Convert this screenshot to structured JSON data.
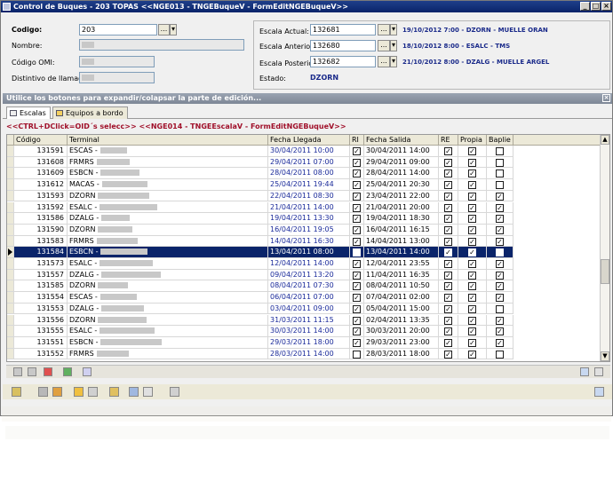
{
  "window": {
    "title": "Control de Buques - 203  TOPAS   <<NGE013 - TNGEBuqueV - FormEditNGEBuqueV>>",
    "btn_min": "_",
    "btn_max": "□",
    "btn_close": "×"
  },
  "form": {
    "codigo_label": "Codigo:",
    "codigo_value": "203",
    "nombre_label": "Nombre:",
    "omi_label": "Código OMI:",
    "distintivo_label": "Distintivo de llamada:",
    "lookup_btn": "...",
    "escala_actual_label": "Escala Actual:",
    "escala_actual_value": "132681",
    "escala_actual_info": "19/10/2012 7:00 - DZORN - MUELLE ORAN",
    "escala_anterior_label": "Escala Anterior:",
    "escala_anterior_value": "132680",
    "escala_anterior_info": "18/10/2012 8:00 - ESALC - TMS",
    "escala_posterior_label": "Escala Posterior:",
    "escala_posterior_value": "132682",
    "escala_posterior_info": "21/10/2012 8:00 - DZALG - MUELLE ARGEL",
    "estado_label": "Estado:",
    "estado_value": "DZORN"
  },
  "infobar": {
    "text": "Utilice los botones para expandir/colapsar la parte de edición..."
  },
  "tabs": [
    {
      "label": "Escalas"
    },
    {
      "label": "Equipos a bordo"
    }
  ],
  "context_line": "<<CTRL+DClick=OID´s selecc>> <<NGE014 - TNGEEscalaV - FormEditNGEBuqueV>>",
  "grid": {
    "columns": [
      "Código",
      "Terminal",
      "Fecha Llegada",
      "RI",
      "Fecha Salida",
      "RE",
      "Propia",
      "Baplie"
    ],
    "rows": [
      {
        "codigo": "131591",
        "terminal": "ESCAS -",
        "llegada": "30/04/2011 10:00",
        "ri": true,
        "salida": "30/04/2011 14:00",
        "re": true,
        "propia": true,
        "baplie": false
      },
      {
        "codigo": "131608",
        "terminal": "FRMRS",
        "llegada": "29/04/2011 07:00",
        "ri": true,
        "salida": "29/04/2011 09:00",
        "re": true,
        "propia": true,
        "baplie": false
      },
      {
        "codigo": "131609",
        "terminal": "ESBCN -",
        "llegada": "28/04/2011 08:00",
        "ri": true,
        "salida": "28/04/2011 14:00",
        "re": true,
        "propia": true,
        "baplie": false
      },
      {
        "codigo": "131612",
        "terminal": "MACAS -",
        "llegada": "25/04/2011 19:44",
        "ri": true,
        "salida": "25/04/2011 20:30",
        "re": true,
        "propia": true,
        "baplie": false
      },
      {
        "codigo": "131593",
        "terminal": "DZORN",
        "llegada": "22/04/2011 08:30",
        "ri": true,
        "salida": "23/04/2011 22:00",
        "re": true,
        "propia": true,
        "baplie": true
      },
      {
        "codigo": "131592",
        "terminal": "ESALC -",
        "llegada": "21/04/2011 14:00",
        "ri": true,
        "salida": "21/04/2011 20:00",
        "re": true,
        "propia": true,
        "baplie": true
      },
      {
        "codigo": "131586",
        "terminal": "DZALG -",
        "llegada": "19/04/2011 13:30",
        "ri": true,
        "salida": "19/04/2011 18:30",
        "re": true,
        "propia": true,
        "baplie": true
      },
      {
        "codigo": "131590",
        "terminal": "DZORN",
        "llegada": "16/04/2011 19:05",
        "ri": true,
        "salida": "16/04/2011 16:15",
        "re": true,
        "propia": true,
        "baplie": true
      },
      {
        "codigo": "131583",
        "terminal": "FRMRS",
        "llegada": "14/04/2011 16:30",
        "ri": true,
        "salida": "14/04/2011 13:00",
        "re": true,
        "propia": true,
        "baplie": true
      },
      {
        "codigo": "131584",
        "terminal": "ESBCN -",
        "llegada": "13/04/2011 08:00",
        "ri": false,
        "salida": "13/04/2011 14:00",
        "re": true,
        "propia": true,
        "baplie": false
      },
      {
        "codigo": "131573",
        "terminal": "ESALC -",
        "llegada": "12/04/2011 14:00",
        "ri": true,
        "salida": "12/04/2011 23:55",
        "re": true,
        "propia": true,
        "baplie": true
      },
      {
        "codigo": "131557",
        "terminal": "DZALG -",
        "llegada": "09/04/2011 13:20",
        "ri": true,
        "salida": "11/04/2011 16:35",
        "re": true,
        "propia": true,
        "baplie": true
      },
      {
        "codigo": "131585",
        "terminal": "DZORN",
        "llegada": "08/04/2011 07:30",
        "ri": true,
        "salida": "08/04/2011 10:50",
        "re": true,
        "propia": true,
        "baplie": true
      },
      {
        "codigo": "131554",
        "terminal": "ESCAS -",
        "llegada": "06/04/2011 07:00",
        "ri": true,
        "salida": "07/04/2011 02:00",
        "re": true,
        "propia": true,
        "baplie": true
      },
      {
        "codigo": "131553",
        "terminal": "DZALG -",
        "llegada": "03/04/2011 09:00",
        "ri": true,
        "salida": "05/04/2011 15:00",
        "re": true,
        "propia": true,
        "baplie": false
      },
      {
        "codigo": "131556",
        "terminal": "DZORN",
        "llegada": "31/03/2011 11:15",
        "ri": true,
        "salida": "02/04/2011 13:35",
        "re": true,
        "propia": true,
        "baplie": true
      },
      {
        "codigo": "131555",
        "terminal": "ESALC -",
        "llegada": "30/03/2011 14:00",
        "ri": true,
        "salida": "30/03/2011 20:00",
        "re": true,
        "propia": true,
        "baplie": true
      },
      {
        "codigo": "131551",
        "terminal": "ESBCN -",
        "llegada": "29/03/2011 18:00",
        "ri": true,
        "salida": "29/03/2011 23:00",
        "re": true,
        "propia": true,
        "baplie": true
      },
      {
        "codigo": "131552",
        "terminal": "FRMRS",
        "llegada": "28/03/2011 14:00",
        "ri": false,
        "salida": "28/03/2011 18:00",
        "re": true,
        "propia": true,
        "baplie": false
      }
    ],
    "selected_index": 9
  }
}
